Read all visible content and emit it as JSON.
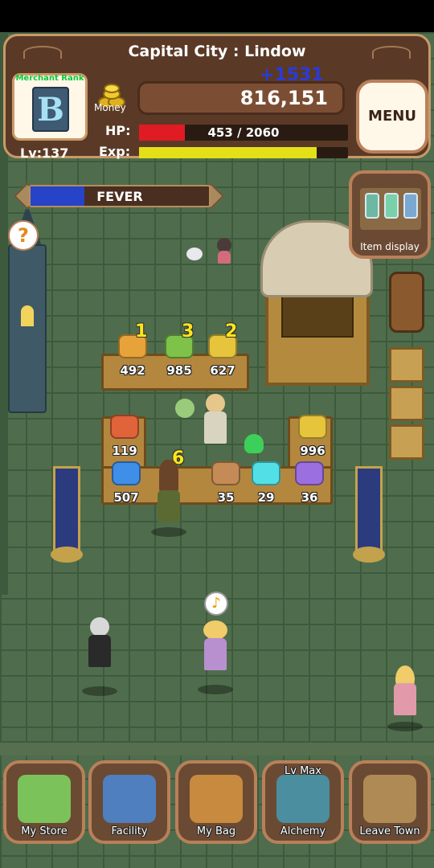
{
  "hud": {
    "location": "Capital City : Lindow",
    "rank_label": "Merchant Rank",
    "rank": "B",
    "level": "Lv:137",
    "money_label": "Money",
    "money": "816,151",
    "money_delta": "+1531",
    "hp_label": "HP:",
    "hp_text": "453 / 2060",
    "hp_fraction": 0.22,
    "exp_label": "Exp:",
    "exp_fraction": 0.85,
    "menu_label": "MENU"
  },
  "fever": {
    "label": "FEVER",
    "fraction": 0.3
  },
  "help": {
    "symbol": "?"
  },
  "item_display": {
    "label": "Item display"
  },
  "shelf_items": [
    {
      "name": "bread",
      "qty": "492",
      "badge": "1",
      "color": "#e8a23a"
    },
    {
      "name": "cabbage",
      "qty": "985",
      "badge": "3",
      "color": "#7ec24a"
    },
    {
      "name": "corn",
      "qty": "627",
      "badge": "2",
      "color": "#e6c43c"
    },
    {
      "name": "meat",
      "qty": "119",
      "badge": "",
      "color": "#e0633a"
    },
    {
      "name": "corn-bundle",
      "qty": "996",
      "badge": "",
      "color": "#e6c43c"
    },
    {
      "name": "blue-crystal",
      "qty": "507",
      "badge": "",
      "color": "#3f8ee8"
    },
    {
      "name": "pouch",
      "qty": "35",
      "badge": "6",
      "color": "#c48b56"
    },
    {
      "name": "orb",
      "qty": "29",
      "badge": "",
      "color": "#52e0e6"
    },
    {
      "name": "purple-crystal",
      "qty": "36",
      "badge": "",
      "color": "#9b6fe0"
    }
  ],
  "speech": {
    "symbol": "♪"
  },
  "nav": [
    {
      "label": "My Store",
      "top": "",
      "color": "#7cc25a"
    },
    {
      "label": "Facility",
      "top": "",
      "color": "#4f7fbe"
    },
    {
      "label": "My Bag",
      "top": "",
      "color": "#c88a3e"
    },
    {
      "label": "Alchemy",
      "top": "Lv Max",
      "color": "#4a8ea0"
    },
    {
      "label": "Leave Town",
      "top": "",
      "color": "#b08a54"
    }
  ]
}
